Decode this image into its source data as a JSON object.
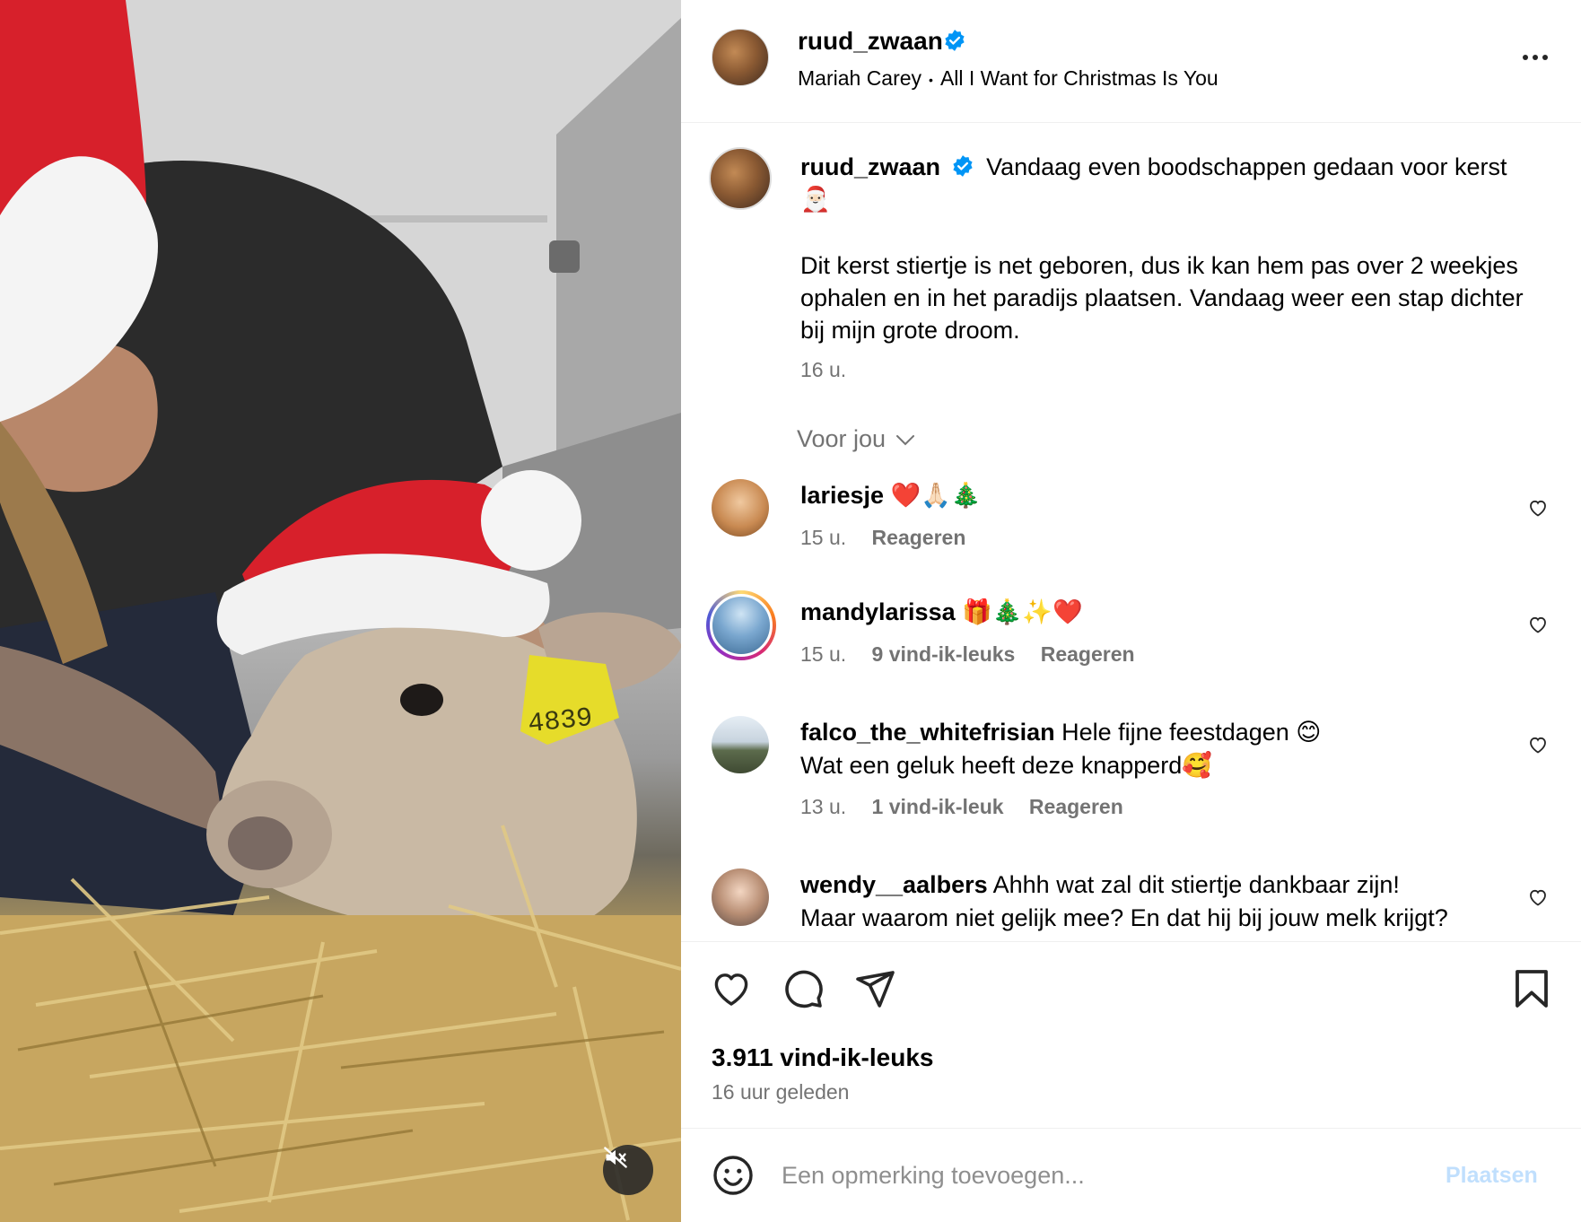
{
  "post": {
    "author": "ruud_zwaan",
    "verified": true,
    "music_artist": "Mariah Carey",
    "music_separator": "•",
    "music_title": "All I Want for Christmas Is You",
    "more_icon": "more-icon",
    "media": {
      "type": "video",
      "description_icon": "video-frame",
      "muted": true,
      "mute_icon": "speaker-muted-icon",
      "ear_tag_number": "4839"
    }
  },
  "caption": {
    "username": "ruud_zwaan",
    "line1": "Vandaag even boodschappen gedaan voor kerst🎅🏻",
    "body": "Dit kerst stiertje is net geboren, dus ik kan hem pas over 2 weekjes ophalen en in het paradijs plaatsen. Vandaag weer een stap dichter bij mijn grote droom.",
    "time": "16 u."
  },
  "filter": {
    "label": "Voor jou",
    "icon": "chevron-down-icon"
  },
  "comments": [
    {
      "username": "lariesje",
      "text": "❤️🙏🏻🎄",
      "time": "15 u.",
      "likes": "",
      "reply": "Reageren"
    },
    {
      "username": "mandylarissa",
      "text": "🎁🎄✨❤️",
      "time": "15 u.",
      "likes": "9 vind-ik-leuks",
      "reply": "Reageren"
    },
    {
      "username": "falco_the_whitefrisian",
      "text": "Hele fijne feestdagen 😊",
      "text2": "Wat een geluk heeft deze knapperd🥰",
      "time": "13 u.",
      "likes": "1 vind-ik-leuk",
      "reply": "Reageren"
    },
    {
      "username": "wendy__aalbers",
      "text": "Ahhh wat zal dit stiertje dankbaar zijn!",
      "text2": "Maar waarom niet gelijk mee? En dat hij bij jouw melk krijgt?"
    }
  ],
  "actions": {
    "like_icon": "heart-icon",
    "comment_icon": "comment-icon",
    "share_icon": "send-icon",
    "save_icon": "bookmark-icon",
    "likes_count": "3.911 vind-ik-leuks",
    "posted": "16 uur geleden"
  },
  "composer": {
    "emoji_icon": "smiley-icon",
    "placeholder": "Een opmerking toevoegen...",
    "post_label": "Plaatsen"
  },
  "colors": {
    "accent": "#0095f6",
    "post_disabled": "#c0dffd",
    "secondary_text": "#737373",
    "verified": "#0095f6"
  }
}
